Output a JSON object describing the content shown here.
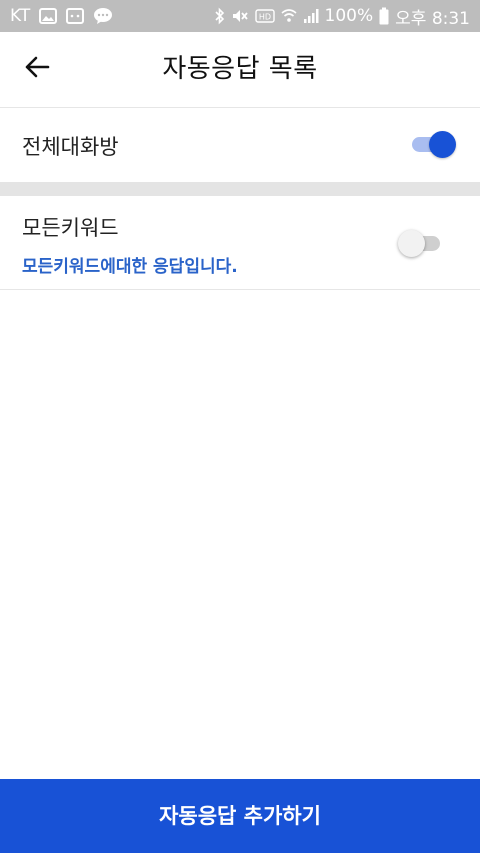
{
  "status_bar": {
    "carrier": "KT",
    "battery": "100%",
    "time": "오후 8:31",
    "left_icons": [
      "gallery-icon",
      "message-icon",
      "chat-bubble-icon"
    ],
    "right_icons": [
      "bluetooth-icon",
      "mute-icon",
      "hd-icon",
      "wifi-icon",
      "signal-icon",
      "battery-icon"
    ]
  },
  "header": {
    "title": "자동응답 목록",
    "back_icon": "back-arrow-icon"
  },
  "rows": [
    {
      "title": "전체대화방",
      "toggle_on": true
    },
    {
      "title": "모든키워드",
      "subtitle": "모든키워드에대한 응답입니다.",
      "toggle_on": false
    }
  ],
  "footer": {
    "add_label": "자동응답 추가하기"
  },
  "colors": {
    "accent": "#1852d6",
    "accent_light": "#a9bdf0",
    "subtitle": "#2a63c9",
    "status_bar": "#bdbdbd",
    "divider": "#e4e4e4"
  }
}
